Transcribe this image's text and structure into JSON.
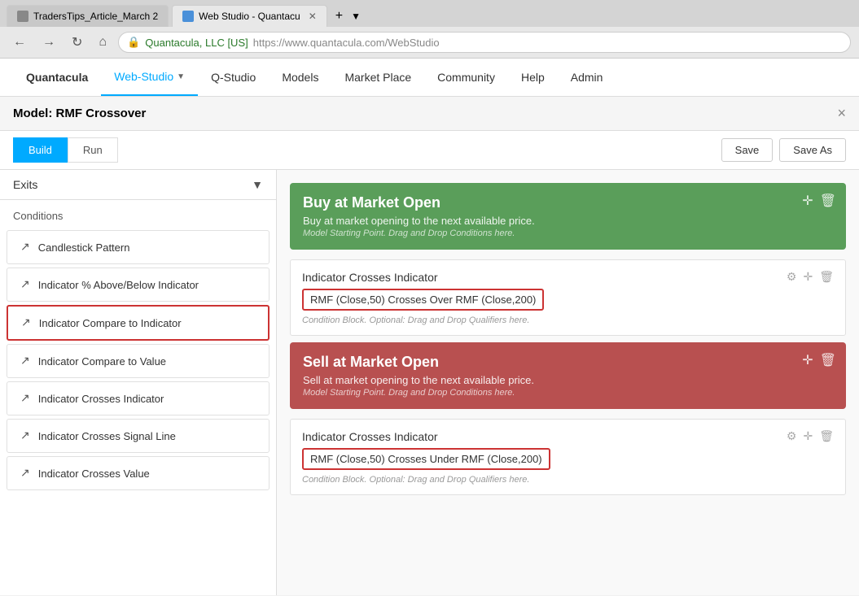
{
  "browser": {
    "tabs": [
      {
        "id": "tab1",
        "label": "TradersTips_Article_March 2",
        "active": false
      },
      {
        "id": "tab2",
        "label": "Web Studio - Quantacu",
        "active": true
      }
    ],
    "url_company": "Quantacula, LLC [US]",
    "url_full": "https://www.quantacula.com/WebStudio",
    "url_https": "https://www.quantacula.com",
    "url_path": "/WebStudio"
  },
  "nav": {
    "brand": "Quantacula",
    "items": [
      {
        "id": "web-studio",
        "label": "Web-Studio",
        "active": true,
        "dropdown": true
      },
      {
        "id": "q-studio",
        "label": "Q-Studio",
        "active": false
      },
      {
        "id": "models",
        "label": "Models",
        "active": false
      },
      {
        "id": "market-place",
        "label": "Market Place",
        "active": false
      },
      {
        "id": "community",
        "label": "Community",
        "active": false
      },
      {
        "id": "help",
        "label": "Help",
        "active": false
      },
      {
        "id": "admin",
        "label": "Admin",
        "active": false
      }
    ]
  },
  "model": {
    "label": "Model:",
    "name": "RMF Crossover",
    "close_label": "×"
  },
  "toolbar": {
    "build_label": "Build",
    "run_label": "Run",
    "save_label": "Save",
    "save_as_label": "Save As"
  },
  "sidebar": {
    "dropdown_label": "Exits",
    "conditions_header": "Conditions",
    "items": [
      {
        "id": "candlestick-pattern",
        "label": "Candlestick Pattern",
        "highlighted": false
      },
      {
        "id": "indicator-pct-above-below",
        "label": "Indicator % Above/Below Indicator",
        "highlighted": false
      },
      {
        "id": "indicator-compare-to-indicator",
        "label": "Indicator Compare to Indicator",
        "highlighted": true
      },
      {
        "id": "indicator-compare-to-value",
        "label": "Indicator Compare to Value",
        "highlighted": false
      },
      {
        "id": "indicator-crosses-indicator",
        "label": "Indicator Crosses Indicator",
        "highlighted": false
      },
      {
        "id": "indicator-crosses-signal-line",
        "label": "Indicator Crosses Signal Line",
        "highlighted": false
      },
      {
        "id": "indicator-crosses-value",
        "label": "Indicator Crosses Value",
        "highlighted": false
      }
    ]
  },
  "buy_block": {
    "title": "Buy at Market Open",
    "subtitle": "Buy at market opening to the next available price.",
    "note": "Model Starting Point. Drag and Drop Conditions here."
  },
  "sell_block": {
    "title": "Sell at Market Open",
    "subtitle": "Sell at market opening to the next available price.",
    "note": "Model Starting Point. Drag and Drop Conditions here."
  },
  "conditions": {
    "buy_condition": {
      "title": "Indicator Crosses Indicator",
      "formula": "RMF (Close,50) Crosses Over RMF (Close,200)",
      "note": "Condition Block. Optional: Drag and Drop Qualifiers here."
    },
    "sell_condition": {
      "title": "Indicator Crosses Indicator",
      "formula": "RMF (Close,50) Crosses Under RMF (Close,200)",
      "note": "Condition Block. Optional: Drag and Drop Qualifiers here."
    }
  }
}
